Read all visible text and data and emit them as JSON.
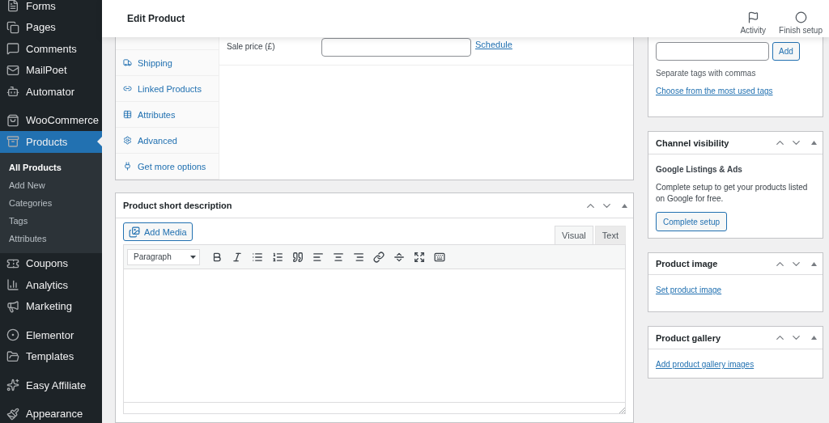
{
  "sidebar": {
    "groups": [
      [
        {
          "label": "Forms",
          "selected": false
        },
        {
          "label": "Pages",
          "selected": false
        },
        {
          "label": "Comments",
          "selected": false
        },
        {
          "label": "MailPoet",
          "selected": false
        },
        {
          "label": "Automator",
          "selected": false
        }
      ],
      [
        {
          "label": "WooCommerce",
          "selected": false
        },
        {
          "label": "Products",
          "selected": true,
          "children": [
            {
              "label": "All Products",
              "selected": true
            },
            {
              "label": "Add New",
              "selected": false
            },
            {
              "label": "Categories",
              "selected": false
            },
            {
              "label": "Tags",
              "selected": false
            },
            {
              "label": "Attributes",
              "selected": false
            }
          ]
        },
        {
          "label": "Coupons",
          "selected": false
        },
        {
          "label": "Analytics",
          "selected": false
        },
        {
          "label": "Marketing",
          "selected": false
        }
      ],
      [
        {
          "label": "Elementor",
          "selected": false
        },
        {
          "label": "Templates",
          "selected": false
        }
      ],
      [
        {
          "label": "Easy Affiliate",
          "selected": false
        }
      ],
      [
        {
          "label": "Appearance",
          "selected": false
        }
      ]
    ]
  },
  "header": {
    "title": "Edit Product",
    "actions": [
      {
        "label": "Activity"
      },
      {
        "label": "Finish setup"
      }
    ]
  },
  "product_data": {
    "tabs": [
      {
        "label": "Shipping",
        "selected": false
      },
      {
        "label": "Linked Products",
        "selected": false
      },
      {
        "label": "Attributes",
        "selected": false
      },
      {
        "label": "Advanced",
        "selected": false
      },
      {
        "label": "Get more options",
        "selected": false
      }
    ],
    "sale_price": {
      "label": "Sale price (£)",
      "link": "Schedule"
    }
  },
  "short_description": {
    "title": "Product short description",
    "add_media": "Add Media",
    "format": "Paragraph",
    "editor_tabs": [
      {
        "label": "Visual",
        "selected": true
      },
      {
        "label": "Text",
        "selected": false
      }
    ]
  },
  "tags": {
    "button": "Add",
    "hint": "Separate tags with commas",
    "link": "Choose from the most used tags"
  },
  "channel_visibility": {
    "title": "Channel visibility",
    "subtitle": "Google Listings & Ads",
    "text": "Complete setup to get your products listed on Google for free.",
    "button": "Complete setup"
  },
  "product_image": {
    "title": "Product image",
    "link": "Set product image"
  },
  "product_gallery": {
    "title": "Product gallery",
    "link": "Add product gallery images"
  }
}
